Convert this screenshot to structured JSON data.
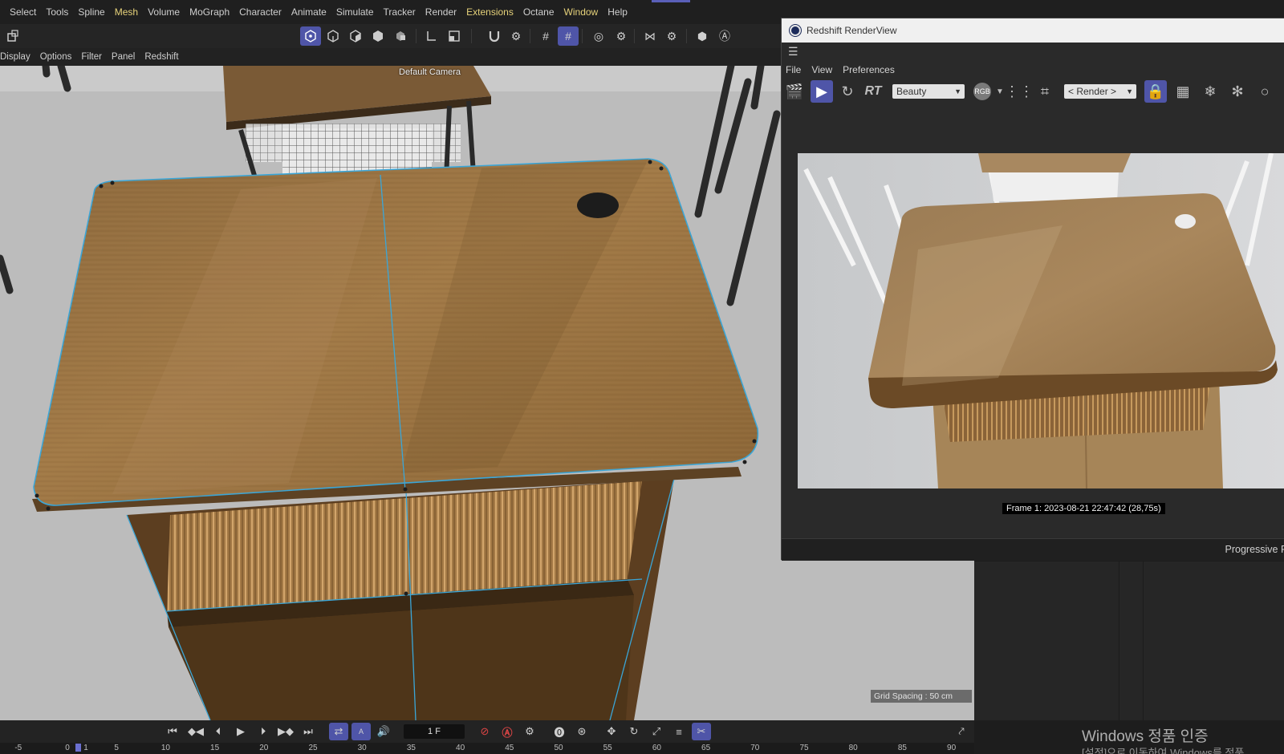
{
  "menubar": {
    "items": [
      {
        "label": "Select",
        "hl": false
      },
      {
        "label": "Tools",
        "hl": false
      },
      {
        "label": "Spline",
        "hl": false
      },
      {
        "label": "Mesh",
        "hl": true
      },
      {
        "label": "Volume",
        "hl": false
      },
      {
        "label": "MoGraph",
        "hl": false
      },
      {
        "label": "Character",
        "hl": false
      },
      {
        "label": "Animate",
        "hl": false
      },
      {
        "label": "Simulate",
        "hl": false
      },
      {
        "label": "Tracker",
        "hl": false
      },
      {
        "label": "Render",
        "hl": false
      },
      {
        "label": "Extensions",
        "hl": true
      },
      {
        "label": "Octane",
        "hl": false
      },
      {
        "label": "Window",
        "hl": true
      },
      {
        "label": "Help",
        "hl": false
      }
    ]
  },
  "viewport_menu": [
    "Display",
    "Options",
    "Filter",
    "Panel",
    "Redshift"
  ],
  "viewport": {
    "camera_label": "Default Camera",
    "grid_spacing": "Grid Spacing : 50 cm"
  },
  "renderview": {
    "title": "Redshift RenderView",
    "menu": [
      "File",
      "View",
      "Preferences"
    ],
    "rt_label": "RT",
    "aov_dropdown": "Beauty",
    "rgb_badge": "RGB",
    "render_dropdown": "< Render >",
    "frame_info": "Frame  1:  2023-08-21  22:47:42  (28,75s)",
    "progressive": "Progressive R"
  },
  "timeline": {
    "current_frame": "1 F",
    "ticks": [
      "-5",
      "0",
      "1",
      "5",
      "10",
      "15",
      "20",
      "25",
      "30",
      "35",
      "40",
      "45",
      "50",
      "55",
      "60",
      "65",
      "70",
      "75",
      "80",
      "85",
      "90"
    ]
  },
  "watermark": {
    "line1": "Windows 정품 인증",
    "line2": "[설정]으로 이동하여 Windows를 정품"
  },
  "colors": {
    "accent": "#4f55a8",
    "menu_highlight": "#e6d27a",
    "selection_edge": "#3aa6d8"
  }
}
